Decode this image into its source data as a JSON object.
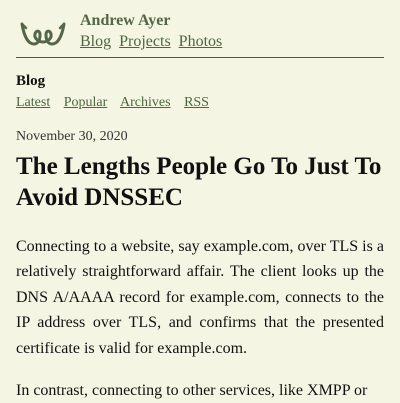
{
  "site": {
    "name": "Andrew Ayer",
    "logo_icon": "horns-logo-icon",
    "nav": [
      "Blog",
      "Projects",
      "Photos"
    ]
  },
  "section": {
    "title": "Blog",
    "nav": [
      "Latest",
      "Popular",
      "Archives",
      "RSS"
    ]
  },
  "post": {
    "date": "November 30, 2020",
    "title": "The Lengths People Go To Just To Avoid DNSSEC",
    "paragraphs": [
      "Connecting to a website, say example.com, over TLS is a relatively straightforward affair. The client looks up the DNS A/AAAA record for example.com, connects to the IP address over TLS, and confirms that the presented certificate is valid for example.com.",
      "In contrast, connecting to other services, like XMPP or"
    ]
  },
  "colors": {
    "background": "#f5f5e3",
    "link": "#4d6640",
    "site_name": "#556648"
  }
}
